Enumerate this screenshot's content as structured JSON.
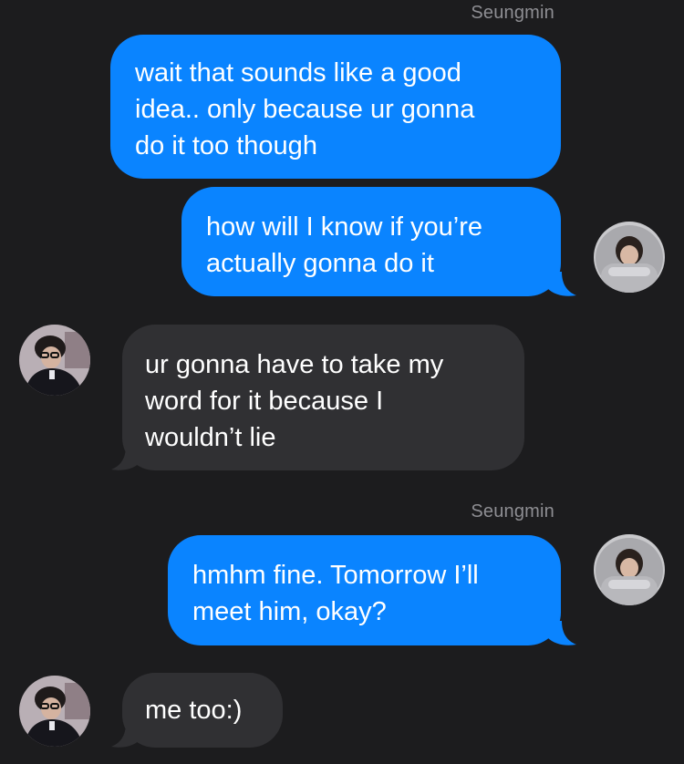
{
  "conversation": {
    "messages": [
      {
        "direction": "outgoing",
        "sender_label": "Seungmin",
        "text_lines": [
          "wait that sounds like a good",
          "idea.. only because ur gonna",
          "do it too though"
        ]
      },
      {
        "direction": "outgoing",
        "text_lines": [
          "how will I know if you’re",
          "actually gonna do it"
        ],
        "avatar": "person-hood-avatar"
      },
      {
        "direction": "incoming",
        "text_lines": [
          "ur gonna have to take my",
          "word for it because I",
          "wouldn’t lie"
        ],
        "avatar": "person-glasses-avatar"
      },
      {
        "direction": "outgoing",
        "sender_label": "Seungmin",
        "text_lines": [
          "hmhm fine. Tomorrow I’ll",
          "meet him, okay?"
        ],
        "avatar": "person-hood-avatar"
      },
      {
        "direction": "incoming",
        "text_lines": [
          "me too:)"
        ],
        "avatar": "person-glasses-avatar"
      }
    ]
  },
  "colors": {
    "background": "#1c1c1e",
    "outgoing_bubble": "#0a84ff",
    "incoming_bubble": "#303033",
    "sender_label": "#8e8e93",
    "text": "#ffffff"
  }
}
